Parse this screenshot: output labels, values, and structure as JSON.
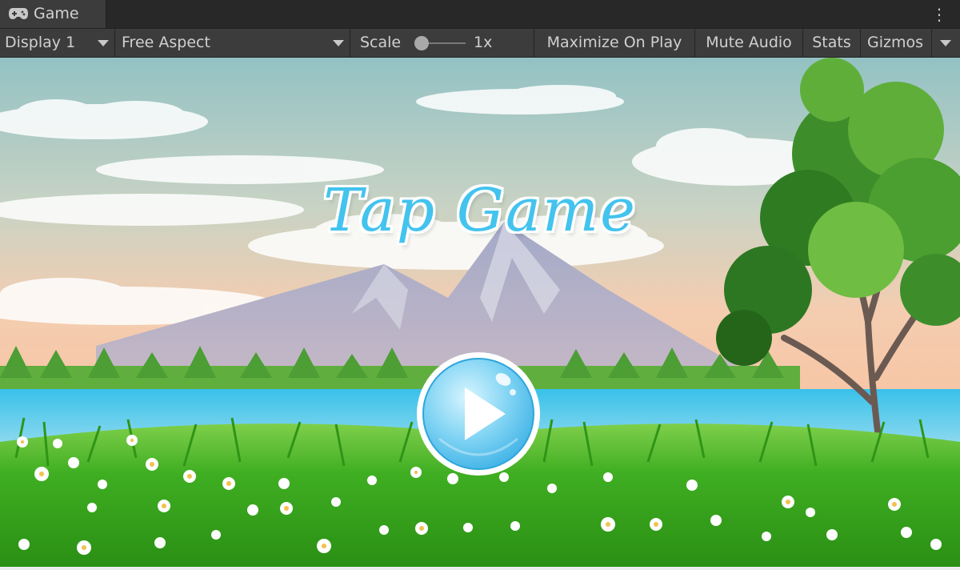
{
  "tab": {
    "label": "Game",
    "icon": "gamepad-icon"
  },
  "menu_icon": "kebab-menu-icon",
  "toolbar": {
    "display": "Display 1",
    "aspect": "Free Aspect",
    "scale_label": "Scale",
    "scale_value": "1x",
    "maximize": "Maximize On Play",
    "mute": "Mute Audio",
    "stats": "Stats",
    "gizmos": "Gizmos"
  },
  "game": {
    "title": "Tap Game",
    "play_icon": "play-icon",
    "colors": {
      "title": "#43c3ee",
      "water": "#2fb4dd",
      "grass": "#3aa31d",
      "sky_top": "#9cc6c6",
      "sky_bottom": "#f7c9a9"
    }
  }
}
